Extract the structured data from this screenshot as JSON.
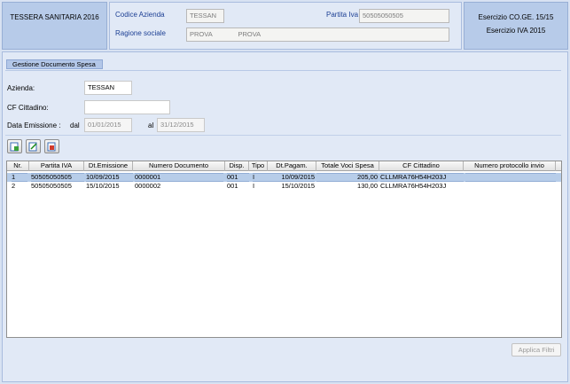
{
  "header": {
    "left_title": "TESSERA SANITARIA 2016",
    "codice_azienda_label": "Codice  Azienda",
    "codice_azienda_value": "TESSAN",
    "partita_iva_label": "Partita Iva",
    "partita_iva_value": "50505050505",
    "ragione_sociale_label": "Ragione sociale",
    "ragione_sociale_value": "PROVA              PROVA",
    "esercizio_coge": "Esercizio CO.GE. 15/15",
    "esercizio_iva": "Esercizio IVA 2015"
  },
  "section": {
    "title": "Gestione Documento Spesa"
  },
  "filters": {
    "azienda_label": "Azienda:",
    "azienda_value": "TESSAN",
    "cf_label": "CF Cittadino:",
    "cf_value": "",
    "data_label": "Data Emissione :",
    "dal_label": "dal",
    "dal_value": "01/01/2015",
    "al_label": "al",
    "al_value": "31/12/2015"
  },
  "toolbar": {
    "icons": [
      "new-document-icon",
      "edit-document-icon",
      "delete-document-icon"
    ]
  },
  "grid": {
    "columns": [
      "Nr.",
      "Partita IVA",
      "Dt.Emissione",
      "Numero Documento",
      "Disp.",
      "Tipo",
      "Dt.Pagam.",
      "Totale Voci Spesa",
      "CF Cittadino",
      "Numero protocollo invio"
    ],
    "rows": [
      [
        "1",
        "50505050505",
        "10/09/2015",
        "0000001",
        "001",
        "I",
        "10/09/2015",
        "205,00",
        "CLLMRA76H54H203J",
        ""
      ],
      [
        "2",
        "50505050505",
        "15/10/2015",
        "0000002",
        "001",
        "I",
        "15/10/2015",
        "130,00",
        "CLLMRA76H54H203J",
        ""
      ]
    ]
  },
  "footer": {
    "apply_label": "Applica Filtri"
  },
  "colors": {
    "panel_dark": "#b7cbe9",
    "panel_light": "#e1e9f6",
    "selected_row": "#b7cde9",
    "label_blue": "#1c3f94"
  }
}
